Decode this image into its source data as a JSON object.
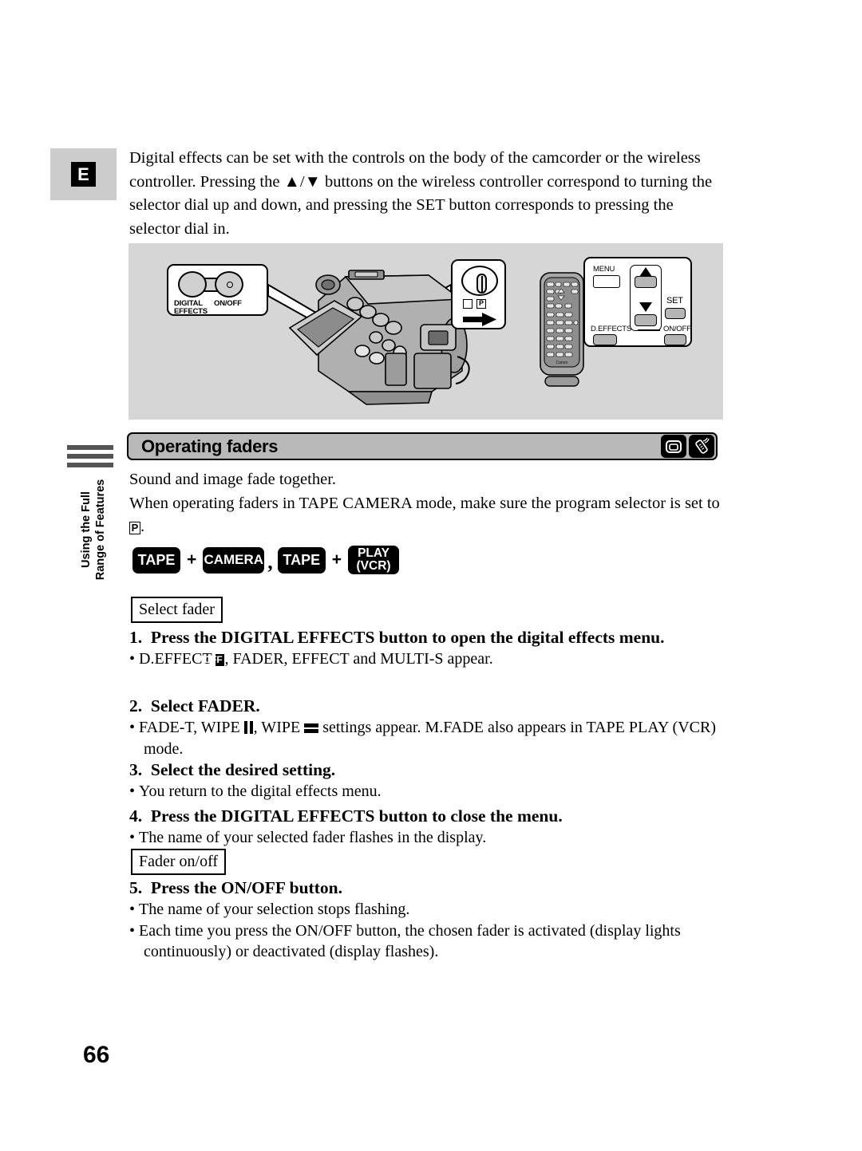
{
  "page": {
    "number": "66",
    "language_marker": "E"
  },
  "side_tab": {
    "line1": "Using the Full",
    "line2": "Range of Features"
  },
  "intro": {
    "paragraph": "Digital effects can be set with the controls on the body of the camcorder or the wireless controller. Pressing the ▲/▼ buttons on the wireless controller correspond to turning the selector dial up and down, and pressing the SET button corresponds to pressing the selector dial in."
  },
  "diagram": {
    "camcorder_callout": {
      "digital_effects_line1": "DIGITAL",
      "digital_effects_line2": "EFFECTS",
      "onoff_label": "ON/OFF"
    },
    "selector_callout": {
      "square_icon": "",
      "program_icon": "P"
    },
    "remote_callout": {
      "menu_label": "MENU",
      "set_label": "SET",
      "deffects_label": "D.EFFECTS",
      "onoff_label": "ON/OFF"
    },
    "remote_brand": "Canon"
  },
  "section": {
    "title": "Operating faders",
    "icons": [
      "camcorder-icon",
      "wireless-controller-icon"
    ]
  },
  "body": {
    "line1": "Sound and image fade together.",
    "line2_part1": "When operating faders in TAPE CAMERA mode, make sure the program selector is set to ",
    "line2_icon": "P",
    "line2_end": "."
  },
  "mode_badges": {
    "tape1": "TAPE",
    "plus1": "+",
    "camera": "CAMERA",
    "comma": ",",
    "tape2": "TAPE",
    "plus2": "+",
    "play_line1": "PLAY",
    "play_line2": "(VCR)"
  },
  "labels": {
    "select_fader": "Select fader",
    "fader_onoff": "Fader on/off"
  },
  "steps": [
    {
      "number": "1.",
      "heading": "Press the DIGITAL EFFECTS button to open the digital effects menu.",
      "bullets": [
        {
          "prefix": "D.EFFECT ",
          "icon": "OFF",
          "suffix": ", FADER, EFFECT and MULTI-S appear."
        }
      ]
    },
    {
      "number": "2.",
      "heading": "Select FADER.",
      "bullets": [
        {
          "prefix": "FADE-T, WIPE ",
          "icon1": "wipe-vertical",
          "mid": ", WIPE ",
          "icon2": "wipe-horizontal",
          "suffix": " settings appear. M.FADE also appears in TAPE PLAY (VCR) mode."
        }
      ]
    },
    {
      "number": "3.",
      "heading": "Select the desired setting.",
      "bullets": [
        {
          "text": "You return to the digital effects menu."
        }
      ]
    },
    {
      "number": "4.",
      "heading": "Press the DIGITAL EFFECTS button to close the menu.",
      "bullets": [
        {
          "text": "The name of your selected fader flashes in the display."
        }
      ]
    },
    {
      "number": "5.",
      "heading": "Press the ON/OFF button.",
      "bullets": [
        {
          "text": "The name of your selection stops flashing."
        },
        {
          "text": "Each time you press the ON/OFF button, the chosen fader is activated (display lights continuously) or deactivated (display flashes)."
        }
      ]
    }
  ],
  "colors": {
    "panel_gray": "#d6d6d6",
    "header_gray": "#b9b9b9",
    "marker_gray": "#cccccc",
    "black": "#000000"
  }
}
